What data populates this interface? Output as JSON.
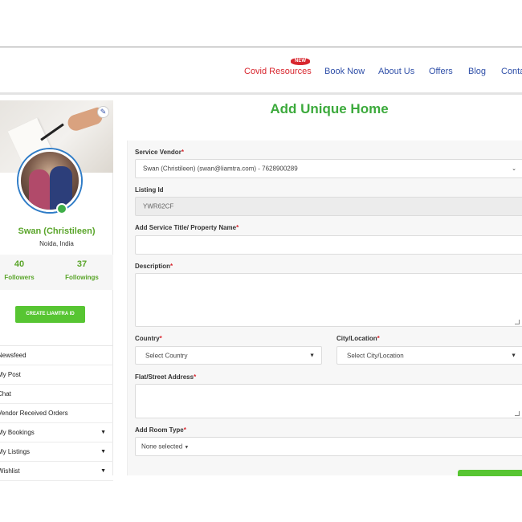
{
  "nav": {
    "items": [
      {
        "label": "Covid Resources",
        "badge": "NEW"
      },
      {
        "label": "Book Now"
      },
      {
        "label": "About Us"
      },
      {
        "label": "Offers"
      },
      {
        "label": "Blog"
      },
      {
        "label": "Conta"
      }
    ]
  },
  "profile": {
    "name": "Swan (Christileen)",
    "location": "Noida, India",
    "followers_count": "40",
    "followers_label": "Followers",
    "followings_count": "37",
    "followings_label": "Followings",
    "create_button": "CREATE LIAMTRA ID"
  },
  "menu": {
    "items": [
      {
        "label": "Newsfeed",
        "has_chevron": false
      },
      {
        "label": "My Post",
        "has_chevron": false
      },
      {
        "label": "Chat",
        "has_chevron": false
      },
      {
        "label": "Vendor Received Orders",
        "has_chevron": false
      },
      {
        "label": "My Bookings",
        "has_chevron": true
      },
      {
        "label": "My Listings",
        "has_chevron": true
      },
      {
        "label": "Wishlist",
        "has_chevron": true
      }
    ]
  },
  "page": {
    "title": "Add Unique Home"
  },
  "form": {
    "service_vendor": {
      "label": "Service Vendor",
      "value": "Swan (Christileen) (swan@liamtra.com) - 7628900289"
    },
    "listing_id": {
      "label": "Listing Id",
      "value": "YWR62CF"
    },
    "title": {
      "label": "Add Service Title/ Property Name",
      "value": ""
    },
    "description": {
      "label": "Description",
      "value": ""
    },
    "country": {
      "label": "Country",
      "value": "Select Country"
    },
    "city": {
      "label": "City/Location",
      "value": "Select City/Location"
    },
    "address": {
      "label": "Flat/Street Address",
      "value": ""
    },
    "room_type": {
      "label": "Add Room Type",
      "value": "None selected"
    }
  },
  "colors": {
    "accent_green": "#57c532",
    "title_green": "#3caa3c",
    "nav_blue": "#2f4fa8",
    "covid_red": "#d8262e",
    "required_red": "#d8262e"
  },
  "icons": {
    "edit": "edit-icon",
    "chevron": "chevron-down-icon",
    "caret": "caret-down-icon"
  }
}
